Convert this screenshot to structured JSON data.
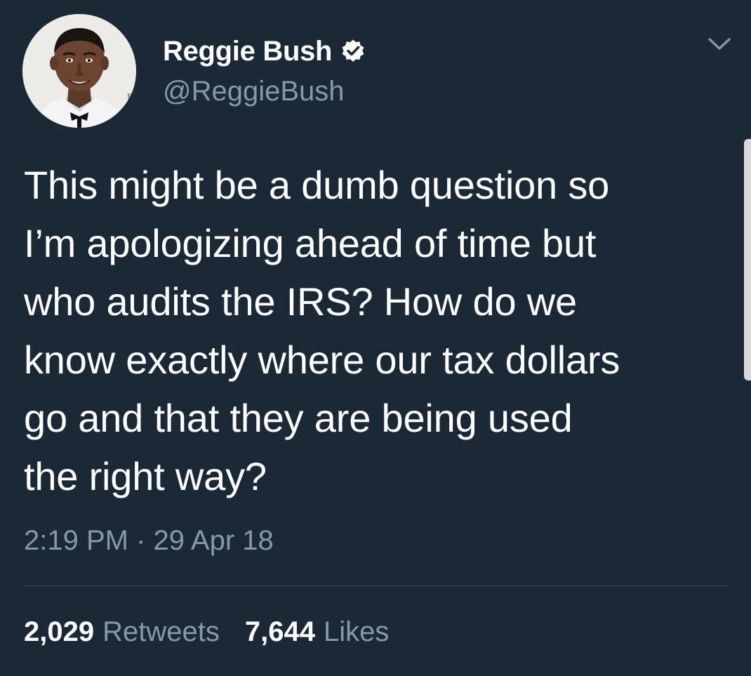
{
  "user": {
    "display_name": "Reggie Bush",
    "handle": "@ReggieBush",
    "verified": true,
    "avatar_icon": "profile-photo"
  },
  "tweet": {
    "text": "This might be a dumb question so\nI’m apologizing ahead of time but\nwho audits the IRS? How do we\nknow exactly where our tax dollars\ngo and that they are being used\nthe right way?",
    "timestamp": "2:19 PM · 29 Apr 18"
  },
  "stats": {
    "retweets_count": "2,029",
    "retweets_label": "Retweets",
    "likes_count": "7,644",
    "likes_label": "Likes"
  },
  "icons": {
    "verified": "verified-badge-icon",
    "menu": "chevron-down-icon"
  },
  "colors": {
    "background": "#1b2836",
    "secondary_text": "#8899a6",
    "divider": "#38444d"
  }
}
